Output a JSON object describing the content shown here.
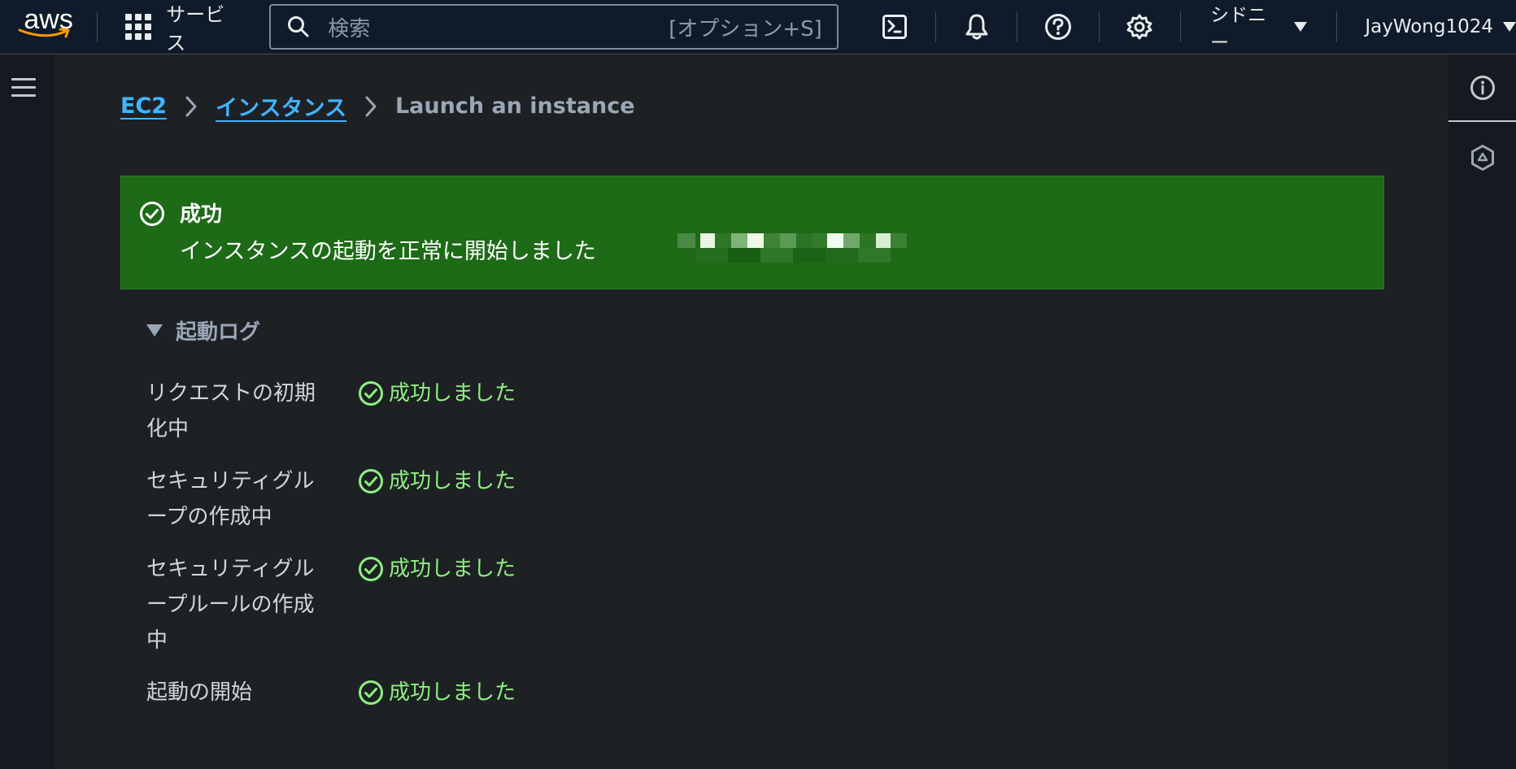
{
  "header": {
    "logo_text": "aws",
    "services_label": "サービス",
    "search_placeholder": "検索",
    "search_shortcut": "[オプション+S]",
    "region_label": "シドニー",
    "user_label": "JayWong1024"
  },
  "breadcrumb": {
    "items": [
      "EC2",
      "インスタンス"
    ],
    "current": "Launch an instance"
  },
  "flash": {
    "title": "成功",
    "message": "インスタンスの起動を正常に開始しました",
    "type": "success",
    "color": "#1d6a17"
  },
  "launch_log": {
    "title": "起動ログ",
    "entries": [
      {
        "label": "リクエストの初期化中",
        "status": "成功しました"
      },
      {
        "label": "セキュリティグループの作成中",
        "status": "成功しました"
      },
      {
        "label": "セキュリティグループルールの作成中",
        "status": "成功しました"
      },
      {
        "label": "起動の開始",
        "status": "成功しました"
      }
    ]
  },
  "colors": {
    "link": "#42b4ff",
    "success_text": "#8ef080",
    "nav_bg": "#0f1b2a"
  },
  "icons": {
    "search": "search-icon",
    "cloudshell": "cloudshell-icon",
    "notifications": "bell-icon",
    "help": "help-icon",
    "settings": "gear-icon",
    "menu": "hamburger-icon",
    "info": "info-icon",
    "hex": "hexagon-icon"
  }
}
